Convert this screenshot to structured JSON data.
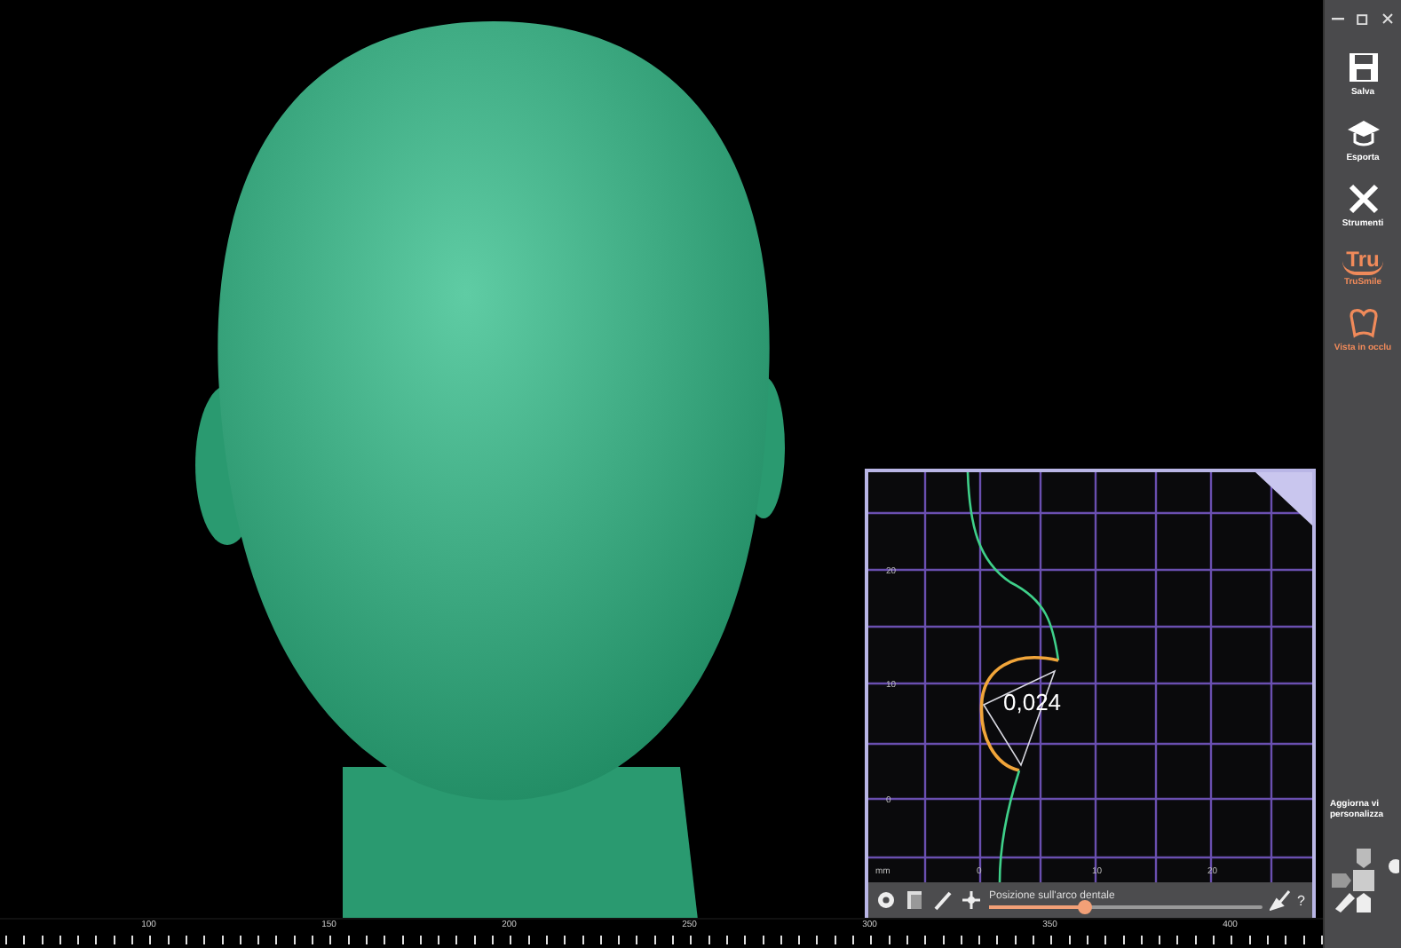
{
  "viewport": {
    "ruler": {
      "labels": [
        "100",
        "150",
        "200",
        "250",
        "300",
        "350",
        "400"
      ]
    }
  },
  "profile_panel": {
    "measurement": "0,024",
    "y_ticks": [
      "20",
      "10",
      "0"
    ],
    "x_unit": "mm",
    "x_ticks": [
      "0",
      "10",
      "20"
    ],
    "toolbar": {
      "label": "Posizione sull'arco dentale",
      "level": 0.35,
      "help": "?"
    }
  },
  "sidebar": {
    "items": [
      {
        "kind": "save",
        "label": "Salva",
        "accent": false
      },
      {
        "kind": "export",
        "label": "Esporta",
        "accent": false
      },
      {
        "kind": "tools",
        "label": "Strumenti",
        "accent": false
      },
      {
        "kind": "trusmile",
        "label": "TruSmile",
        "logo": "Tru",
        "accent": true
      },
      {
        "kind": "occlusion",
        "label": "Vista in occlu",
        "accent": true
      }
    ],
    "update_lines": [
      "Aggiorna vi",
      "personalizza"
    ]
  }
}
